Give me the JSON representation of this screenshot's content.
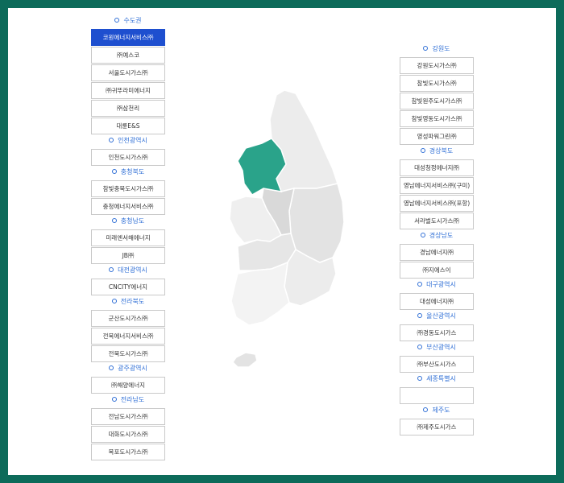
{
  "left_groups": [
    {
      "region": "수도권",
      "companies": [
        "코원에너지서비스㈜",
        "㈜예스코",
        "서울도시가스㈜",
        "㈜귀뚜라미에너지",
        "㈜삼천리",
        "대륜E&S"
      ]
    },
    {
      "region": "인천광역시",
      "companies": [
        "인천도시가스㈜"
      ]
    },
    {
      "region": "충청북도",
      "companies": [
        "참빛충북도시가스㈜",
        "충청에너지서비스㈜"
      ]
    },
    {
      "region": "충청남도",
      "companies": [
        "미래엔서해에너지",
        "JB㈜"
      ]
    },
    {
      "region": "대전광역시",
      "companies": [
        "CNCITY에너지"
      ]
    },
    {
      "region": "전라북도",
      "companies": [
        "군산도시가스㈜",
        "전북에너지서비스㈜",
        "전북도시가스㈜"
      ]
    },
    {
      "region": "광주광역시",
      "companies": [
        "㈜해양에너지"
      ]
    },
    {
      "region": "전라남도",
      "companies": [
        "전남도시가스㈜",
        "대화도시가스㈜",
        "목포도시가스㈜"
      ]
    }
  ],
  "right_groups": [
    {
      "region": "강원도",
      "companies": [
        "강원도시가스㈜",
        "참빛도시가스㈜",
        "참빛원주도시가스㈜",
        "참빛영동도시가스㈜",
        "영성파워그린㈜"
      ]
    },
    {
      "region": "경상북도",
      "companies": [
        "대성청정에너지㈜",
        "영남에너지서비스㈜(구미)",
        "영남에너지서비스㈜(포항)",
        "서라벌도시가스㈜"
      ]
    },
    {
      "region": "경상남도",
      "companies": [
        "경남에너지㈜",
        "㈜지에스이"
      ]
    },
    {
      "region": "대구광역시",
      "companies": [
        "대성에너지㈜"
      ]
    },
    {
      "region": "울산광역시",
      "companies": [
        "㈜경동도시가스"
      ]
    },
    {
      "region": "부산광역시",
      "companies": [
        "㈜부산도시가스"
      ]
    },
    {
      "region": "세종특별시",
      "companies": [
        ""
      ]
    },
    {
      "region": "제주도",
      "companies": [
        "㈜제주도시가스"
      ]
    }
  ],
  "selected": "코원에너지서비스㈜",
  "map": {
    "highlight_region": "수도권",
    "highlight_color": "#2aa38a"
  }
}
